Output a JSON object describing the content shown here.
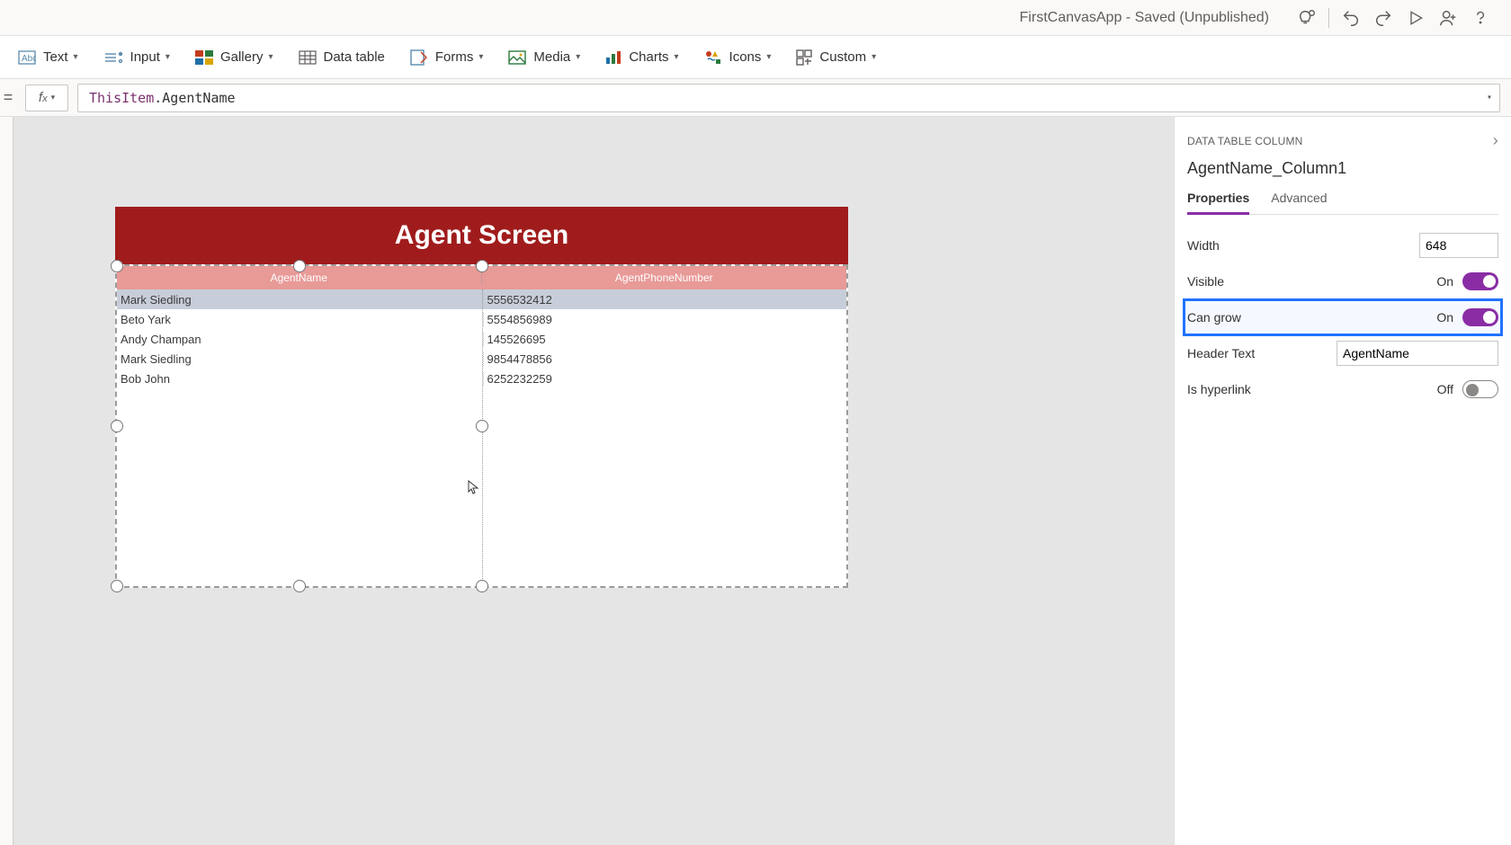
{
  "titlebar": {
    "app_title": "FirstCanvasApp - Saved (Unpublished)"
  },
  "ribbon": {
    "text": "Text",
    "input": "Input",
    "gallery": "Gallery",
    "data_table": "Data table",
    "forms": "Forms",
    "media": "Media",
    "charts": "Charts",
    "icons": "Icons",
    "custom": "Custom"
  },
  "formula": {
    "this_item": "ThisItem",
    "rest": ".AgentName"
  },
  "screen": {
    "title": "Agent Screen",
    "columns": [
      "AgentName",
      "AgentPhoneNumber"
    ],
    "rows": [
      {
        "name": "Mark Siedling",
        "phone": "5556532412",
        "selected": true
      },
      {
        "name": "Beto Yark",
        "phone": "5554856989",
        "selected": false
      },
      {
        "name": "Andy Champan",
        "phone": "145526695",
        "selected": false
      },
      {
        "name": "Mark Siedling",
        "phone": "9854478856",
        "selected": false
      },
      {
        "name": "Bob John",
        "phone": "6252232259",
        "selected": false
      }
    ]
  },
  "props": {
    "section": "DATA TABLE COLUMN",
    "name": "AgentName_Column1",
    "tabs": {
      "properties": "Properties",
      "advanced": "Advanced"
    },
    "width_label": "Width",
    "width_value": "648",
    "visible_label": "Visible",
    "visible_value": "On",
    "cangrow_label": "Can grow",
    "cangrow_value": "On",
    "headertext_label": "Header Text",
    "headertext_value": "AgentName",
    "ishyperlink_label": "Is hyperlink",
    "ishyperlink_value": "Off"
  }
}
